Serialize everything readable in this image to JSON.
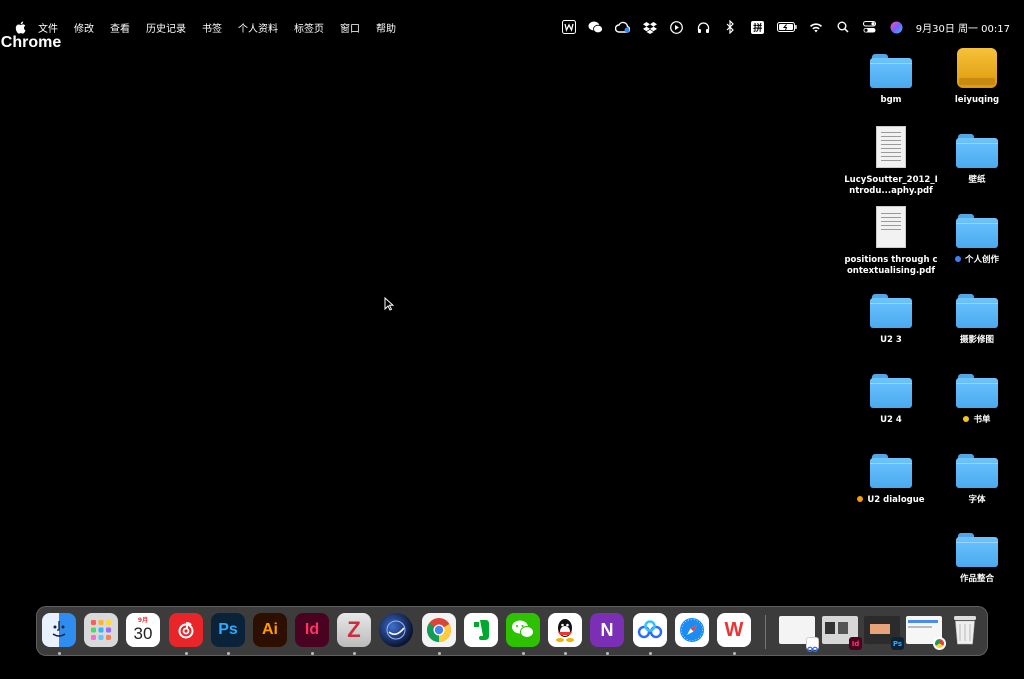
{
  "menubar": {
    "apple_icon": "apple-logo",
    "app_name": "Chrome",
    "menus": [
      "文件",
      "修改",
      "查看",
      "历史记录",
      "书签",
      "个人资料",
      "标签页",
      "窗口",
      "帮助"
    ],
    "status_icons": [
      "wps-icon",
      "wechat-icon",
      "creative-cloud-icon",
      "dropbox-icon",
      "play-icon",
      "headphones-icon",
      "bluetooth-icon",
      "input-method-icon",
      "battery-icon",
      "wifi-icon",
      "search-icon",
      "control-center-icon",
      "siri-icon"
    ],
    "input_method": "拼",
    "clock": "9月30日 周一 00:17"
  },
  "desktop": {
    "items": [
      {
        "label": "bgm",
        "kind": "folder"
      },
      {
        "label": "leiyuqing",
        "kind": "drive"
      },
      {
        "label": "LucySoutter_2012_Introdu...aphy.pdf",
        "kind": "pdf"
      },
      {
        "label": "壁纸",
        "kind": "folder"
      },
      {
        "label": "positions through contextualising.pdf",
        "kind": "pdf"
      },
      {
        "label": "个人创作",
        "kind": "folder",
        "tag": "#3b82f6"
      },
      {
        "label": "U2 3",
        "kind": "folder"
      },
      {
        "label": "摄影修图",
        "kind": "folder"
      },
      {
        "label": "U2 4",
        "kind": "folder"
      },
      {
        "label": "书单",
        "kind": "folder",
        "tag": "#f5c518"
      },
      {
        "label": "U2 dialogue",
        "kind": "folder",
        "tag": "#f59e0b"
      },
      {
        "label": "字体",
        "kind": "folder"
      },
      {
        "label": "作品整合",
        "kind": "folder"
      }
    ]
  },
  "dock": {
    "apps": [
      {
        "name": "finder-icon",
        "glyph": "",
        "bg": "#2f8cf0"
      },
      {
        "name": "launchpad-icon",
        "glyph": "",
        "bg": "#d9d9d9"
      },
      {
        "name": "calendar-icon",
        "glyph": "30",
        "month": "9月",
        "bg": "#ffffff"
      },
      {
        "name": "netease-music-icon",
        "glyph": "",
        "bg": "#e8262a"
      },
      {
        "name": "photoshop-icon",
        "glyph": "Ps",
        "bg": "#0b2338"
      },
      {
        "name": "illustrator-icon",
        "glyph": "Ai",
        "bg": "#2d0f00"
      },
      {
        "name": "indesign-icon",
        "glyph": "Id",
        "bg": "#49021f"
      },
      {
        "name": "zotero-icon",
        "glyph": "Z",
        "bg": "#c9303b"
      },
      {
        "name": "cinema4d-icon",
        "glyph": "",
        "bg": "#1a2c5b"
      },
      {
        "name": "chrome-icon",
        "glyph": "",
        "bg": "#ffffff"
      },
      {
        "name": "evernote-icon",
        "glyph": "",
        "bg": "#ffffff"
      },
      {
        "name": "wechat-icon",
        "glyph": "",
        "bg": "#2dc100"
      },
      {
        "name": "qq-icon",
        "glyph": "",
        "bg": "#ffffff"
      },
      {
        "name": "onenote-icon",
        "glyph": "N",
        "bg": "#7b2fb5"
      },
      {
        "name": "baidu-netdisk-icon",
        "glyph": "",
        "bg": "#ffffff"
      },
      {
        "name": "safari-icon",
        "glyph": "",
        "bg": "#ffffff"
      },
      {
        "name": "wps-icon",
        "glyph": "W",
        "bg": "#ffffff"
      }
    ],
    "recent_thumbnails": [
      "baidu-netdisk-window-thumbnail",
      "indesign-window-thumbnail",
      "photoshop-window-thumbnail",
      "chrome-window-thumbnail"
    ],
    "trash": "trash-icon"
  }
}
